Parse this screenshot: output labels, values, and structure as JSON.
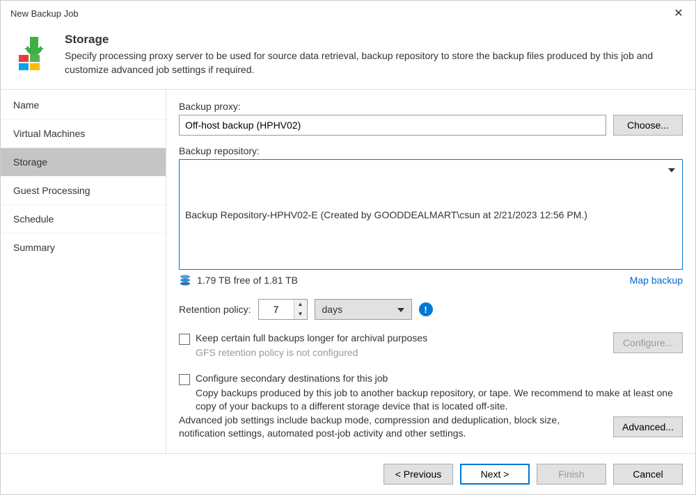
{
  "window": {
    "title": "New Backup Job"
  },
  "header": {
    "title": "Storage",
    "subtitle": "Specify processing proxy server to be used for source data retrieval, backup repository to store the backup files produced by this job and customize advanced job settings if required."
  },
  "sidebar": {
    "items": [
      {
        "label": "Name",
        "active": false
      },
      {
        "label": "Virtual Machines",
        "active": false
      },
      {
        "label": "Storage",
        "active": true
      },
      {
        "label": "Guest Processing",
        "active": false
      },
      {
        "label": "Schedule",
        "active": false
      },
      {
        "label": "Summary",
        "active": false
      }
    ]
  },
  "main": {
    "proxy_label": "Backup proxy:",
    "proxy_value": "Off-host backup (HPHV02)",
    "choose_label": "Choose...",
    "repo_label": "Backup repository:",
    "repo_value": "Backup Repository-HPHV02-E (Created by GOODDEALMART\\csun at 2/21/2023 12:56 PM.)",
    "free_text": "1.79 TB free of 1.81 TB",
    "map_label": "Map backup",
    "retention_label": "Retention policy:",
    "retention_value": "7",
    "retention_unit": "days",
    "gfs_check_label": "Keep certain full backups longer for archival purposes",
    "gfs_sub": "GFS retention policy is not configured",
    "configure_label": "Configure...",
    "secondary_label": "Configure secondary destinations for this job",
    "secondary_desc": "Copy backups produced by this job to another backup repository, or tape. We recommend to make at least one copy of your backups to a different storage device that is located off-site.",
    "advanced_text": "Advanced job settings include backup mode, compression and deduplication, block size, notification settings, automated post-job activity and other settings.",
    "advanced_label": "Advanced..."
  },
  "footer": {
    "previous": "< Previous",
    "next": "Next >",
    "finish": "Finish",
    "cancel": "Cancel"
  }
}
